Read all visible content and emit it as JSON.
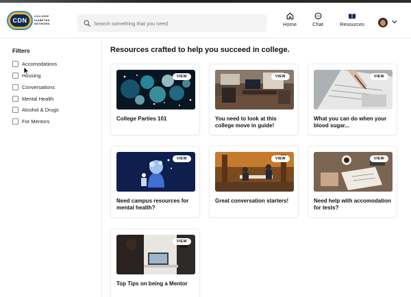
{
  "header": {
    "logo_text": "CDN",
    "logo_subtext": [
      "COLLEGE",
      "DIABETES",
      "NETWORK"
    ],
    "search_placeholder": "Search something that you need",
    "nav": [
      {
        "label": "Home",
        "icon": "home-icon"
      },
      {
        "label": "Chat",
        "icon": "chat-icon"
      },
      {
        "label": "Resources",
        "icon": "book-icon"
      }
    ]
  },
  "sidebar": {
    "title": "Filters",
    "filters": [
      "Accomodations",
      "Housing",
      "Conversations",
      "Mental Health",
      "Alcohol & Drugs",
      "For Mentors"
    ]
  },
  "main": {
    "title": "Resources crafted to help you succeed in college.",
    "view_label": "VIEW",
    "cards": [
      {
        "title": "College Parties 101"
      },
      {
        "title": "You need to look at this college move in guide!"
      },
      {
        "title": "What you can do when your blood sugar..."
      },
      {
        "title": "Need campus resources for mental health?"
      },
      {
        "title": "Great conversation starters!"
      },
      {
        "title": "Need help with accomodation for tests?"
      },
      {
        "title": "Top Tips on being a Mentor"
      }
    ]
  },
  "colors": {
    "logo_navy": "#0d2b55",
    "logo_gold": "#f2b233",
    "logo_blue": "#2a86c8"
  }
}
